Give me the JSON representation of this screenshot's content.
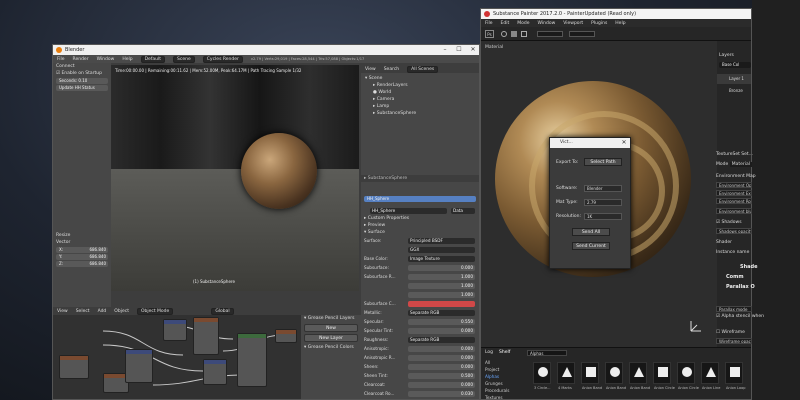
{
  "blender": {
    "title": "Blender",
    "menus": [
      "File",
      "Render",
      "Window",
      "Help"
    ],
    "layout": "Default",
    "scene": "Scene",
    "engine": "Cycles Render",
    "stats": "v2.79 | Verts:29,019 | Faces:28,544 | Tris:57,088 | Objects:1/17",
    "viewport_info_1": "Time:00:00.00 | Remaining:00:11.62 | Mem:52.00M, Peak:64.17M | Path Tracing Sample 1/32",
    "viewport_object": "(1) SubstanceSphere",
    "left_panel": {
      "connect": "Connect",
      "enable": "Enable on Startup",
      "seconds": "Seconds: 0.10",
      "update": "Update HH Status",
      "resize": "Resize",
      "vector": "Vector",
      "x": "X:",
      "y": "Y:",
      "z": "Z:",
      "xv": "686.840",
      "yv": "686.840",
      "zv": "686.840"
    },
    "view_menu": [
      "View",
      "Search",
      "All Scenes"
    ],
    "outliner": {
      "items": [
        "Scene",
        "RenderLayers",
        "World",
        "Camera",
        "Lamp",
        "SubstanceSphere"
      ]
    },
    "props": {
      "object": "HH_Sphere",
      "breadcrumb": "SubstanceSphere",
      "material_slot": "HH_Sphere",
      "data": "Data",
      "custom_props": "Custom Properties",
      "preview": "Preview",
      "surface_head": "Surface",
      "rows": [
        {
          "label": "Surface:",
          "value": "Principled BSDF",
          "kind": "sel"
        },
        {
          "label": "",
          "value": "GGX",
          "kind": "sel"
        },
        {
          "label": "Base Color:",
          "value": "Image Texture",
          "kind": "sel"
        },
        {
          "label": "Subsurface:",
          "value": "0.000",
          "kind": "num"
        },
        {
          "label": "Subsurface R...",
          "value": "1.000",
          "kind": "num"
        },
        {
          "label": "",
          "value": "1.000",
          "kind": "num"
        },
        {
          "label": "",
          "value": "1.000",
          "kind": "num"
        },
        {
          "label": "Subsurface C...",
          "value": "",
          "kind": "red"
        },
        {
          "label": "Metallic:",
          "value": "Separate RGB",
          "kind": "sel"
        },
        {
          "label": "Specular:",
          "value": "0.550",
          "kind": "num"
        },
        {
          "label": "Specular Tint:",
          "value": "0.000",
          "kind": "num"
        },
        {
          "label": "Roughness:",
          "value": "Separate RGB",
          "kind": "sel"
        },
        {
          "label": "Anisotropic:",
          "value": "0.000",
          "kind": "num"
        },
        {
          "label": "Anisotropic R...",
          "value": "0.000",
          "kind": "num"
        },
        {
          "label": "Sheen:",
          "value": "0.000",
          "kind": "num"
        },
        {
          "label": "Sheen Tint:",
          "value": "0.500",
          "kind": "num"
        },
        {
          "label": "Clearcoat:",
          "value": "0.000",
          "kind": "num"
        },
        {
          "label": "Clearcoat Ro...",
          "value": "0.030",
          "kind": "num"
        },
        {
          "label": "IOR:",
          "value": "1.450",
          "kind": "num"
        }
      ]
    },
    "node_menu": [
      "View",
      "Select",
      "Add",
      "Object"
    ],
    "node_mode": "Object Mode",
    "node_global": "Global",
    "gpencil": {
      "head": "Grease Pencil Layers",
      "new": "New",
      "new_layer": "New Layer",
      "colors": "Grease Pencil Colors"
    }
  },
  "painter": {
    "title": "Substance Painter 2017.2.0 - PainterUpdated (Read only)",
    "menus": [
      "File",
      "Edit",
      "Mode",
      "Window",
      "Viewport",
      "Plugins",
      "Help"
    ],
    "viewport_label": "Material",
    "dialog": {
      "title": "Vict...",
      "export_to": "Export To:",
      "select_path": "Select Path",
      "software_label": "Software:",
      "software": "Blender",
      "mat_type_label": "Mat Type:",
      "mat_type": "2.79",
      "resolution_label": "Resolution:",
      "resolution": "1K",
      "send_all": "Send All",
      "send_current": "Send Current"
    },
    "layers": {
      "head": "Layers",
      "blend": "Base Col",
      "layer1": "Layer 1",
      "layer2": "Bronze"
    },
    "shelf": {
      "tabs": [
        "Log",
        "Shelf"
      ],
      "search": "Alphas",
      "categories": [
        "All",
        "Project",
        "Alphas",
        "Grunges",
        "Procedurals",
        "Textures"
      ],
      "brushes": [
        "3 Circle...",
        "4 Marks",
        "Anion Band",
        "Anion Band",
        "Anion Band",
        "Anion Circle",
        "Anion Circle",
        "Anion Line",
        "Anion Loop"
      ]
    }
  },
  "texture_set": {
    "head": "TextureSet Set...",
    "mode": "Mode",
    "material": "Material",
    "env_map": "Environment Map",
    "env_opacity": "Environment Opac",
    "env_exposure": "Environment Expo",
    "env_rotation": "Environment Rotati",
    "blur": "Environment blur",
    "shadows": "Shadows",
    "shadows_opacity": "Shadows opacity",
    "shader": "Shader",
    "instance": "Instance name",
    "shader_head": "Shade",
    "common": "Comm",
    "parallax": "Parallax O",
    "parallax_mode": "Parallax mode",
    "alpha": "Alpha stencil when",
    "wireframe": "Wireframe",
    "wire_opacity": "Wireframe opacity"
  }
}
